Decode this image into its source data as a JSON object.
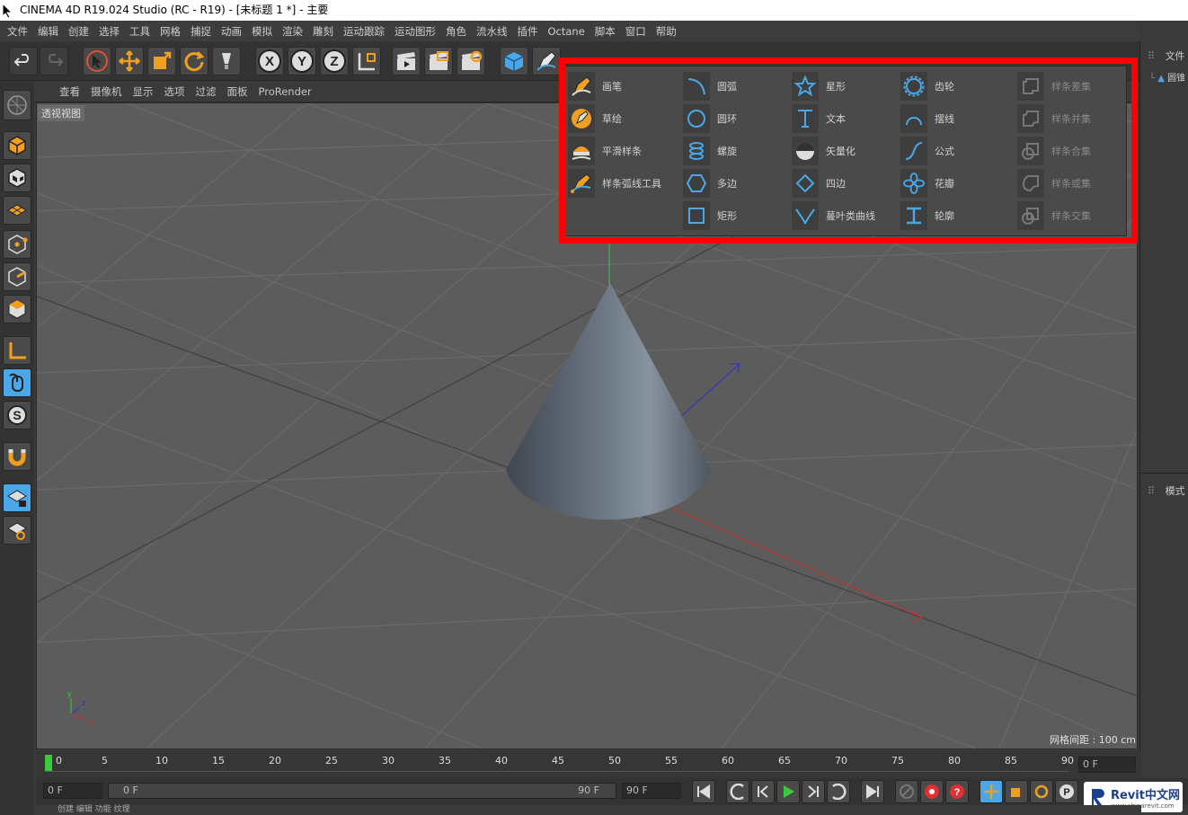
{
  "window_title": "CINEMA 4D R19.024 Studio (RC - R19) - [未标题 1 *] - 主要",
  "menu": [
    "文件",
    "编辑",
    "创建",
    "选择",
    "工具",
    "网格",
    "捕捉",
    "动画",
    "模拟",
    "渲染",
    "雕刻",
    "运动跟踪",
    "运动图形",
    "角色",
    "流水线",
    "插件",
    "Octane",
    "脚本",
    "窗口",
    "帮助"
  ],
  "view_menu": [
    "查看",
    "摄像机",
    "显示",
    "选项",
    "过滤",
    "面板",
    "ProRender"
  ],
  "viewport": {
    "label": "透视视图",
    "grid_spacing": "网格间距 : 100 cm"
  },
  "axis_buttons": [
    "X",
    "Y",
    "Z"
  ],
  "popup": {
    "col1": [
      "画笔",
      "草绘",
      "平滑样条",
      "样条弧线工具"
    ],
    "col2": [
      "圆弧",
      "圆环",
      "螺旋",
      "多边",
      "矩形"
    ],
    "col3": [
      "星形",
      "文本",
      "矢量化",
      "四边",
      "蔓叶类曲线"
    ],
    "col4": [
      "齿轮",
      "摆线",
      "公式",
      "花瓣",
      "轮廓"
    ],
    "col5": [
      "样条差集",
      "样条并集",
      "样条合集",
      "样条或集",
      "样条交集"
    ]
  },
  "right_panel": {
    "file_tab": "文件",
    "object_item": "圆锥",
    "mode_tab": "模式"
  },
  "timeline": {
    "ticks": [
      "0",
      "5",
      "10",
      "15",
      "20",
      "25",
      "30",
      "35",
      "40",
      "45",
      "50",
      "55",
      "60",
      "65",
      "70",
      "75",
      "80",
      "85",
      "90"
    ],
    "current_frame": "0 F",
    "start_field": "0 F",
    "range_start": "0 F",
    "range_end": "90 F",
    "end_field": "90 F"
  },
  "status_bar": "创建  编辑  功能  纹理",
  "watermark": {
    "brand": "Revit中文网",
    "url": "www.chinarevit.com"
  },
  "colors": {
    "accent_red": "#ff0000",
    "icon_blue": "#4aa8e8",
    "icon_orange": "#f0a020",
    "play_green": "#3ec83e"
  }
}
